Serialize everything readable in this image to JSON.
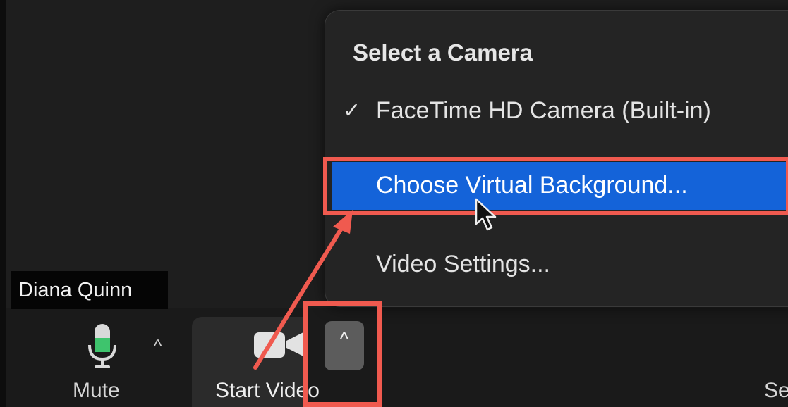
{
  "participant": {
    "name": "Diana Quinn"
  },
  "camera_menu": {
    "heading": "Select a Camera",
    "camera_option": {
      "label": "FaceTime HD Camera (Built-in)",
      "checked": true
    },
    "virtual_background": {
      "label": "Choose Virtual Background..."
    },
    "video_settings": {
      "label": "Video Settings..."
    }
  },
  "toolbar": {
    "mute_label": "Mute",
    "start_video_label": "Start Video",
    "truncated_label": "Se"
  },
  "colors": {
    "highlight": "#1463d9",
    "annotation_red": "#f05a4f",
    "mic_green": "#3ec46d"
  },
  "icons": {
    "check": "✓",
    "caret": "^"
  }
}
